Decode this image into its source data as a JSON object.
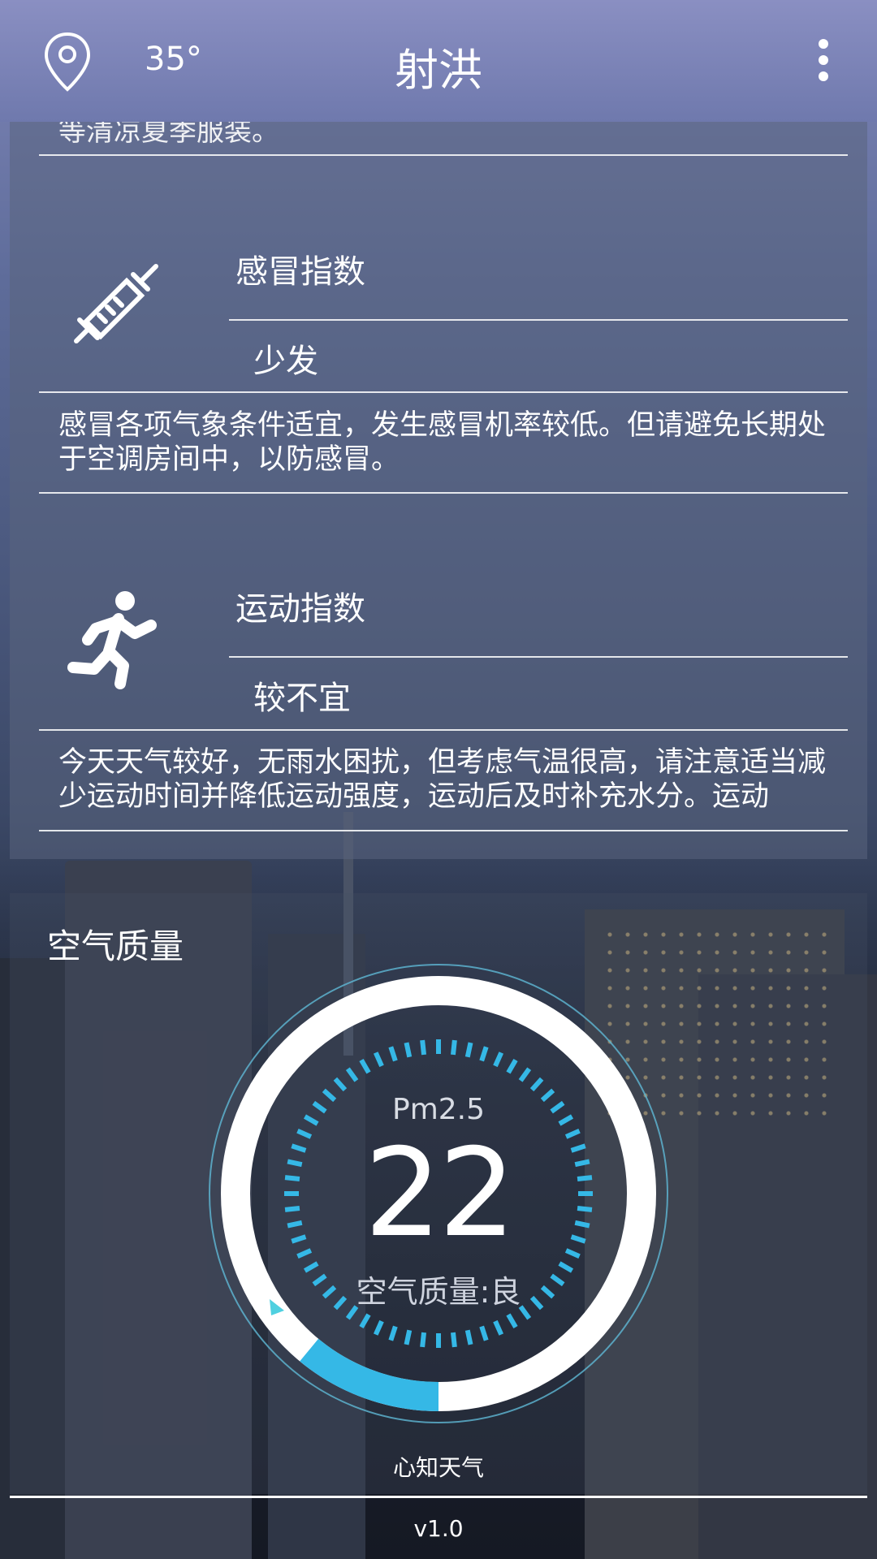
{
  "header": {
    "temperature": "35°",
    "city": "射洪",
    "location_icon": "map-pin-icon",
    "menu_icon": "more-vertical-icon"
  },
  "life_index": {
    "previous_item_tail": "等清凉夏季服装。",
    "items": [
      {
        "icon": "syringe-icon",
        "name": "感冒指数",
        "level": "少发",
        "description": "感冒各项气象条件适宜，发生感冒机率较低。但请避免长期处于空调房间中，以防感冒。"
      },
      {
        "icon": "running-person-icon",
        "name": "运动指数",
        "level": "较不宜",
        "description": "今天天气较好，无雨水困扰，但考虑气温很高，请注意适当减少运动时间并降低运动强度，运动后及时补充水分。运动"
      }
    ]
  },
  "air_quality": {
    "title": "空气质量",
    "pm_label": "Pm2.5",
    "pm_value": "22",
    "status": "空气质量:良",
    "gauge_fraction": 0.11,
    "accent_color": "#35b8e6"
  },
  "footer": {
    "provider": "心知天气",
    "version": "v1.0"
  }
}
